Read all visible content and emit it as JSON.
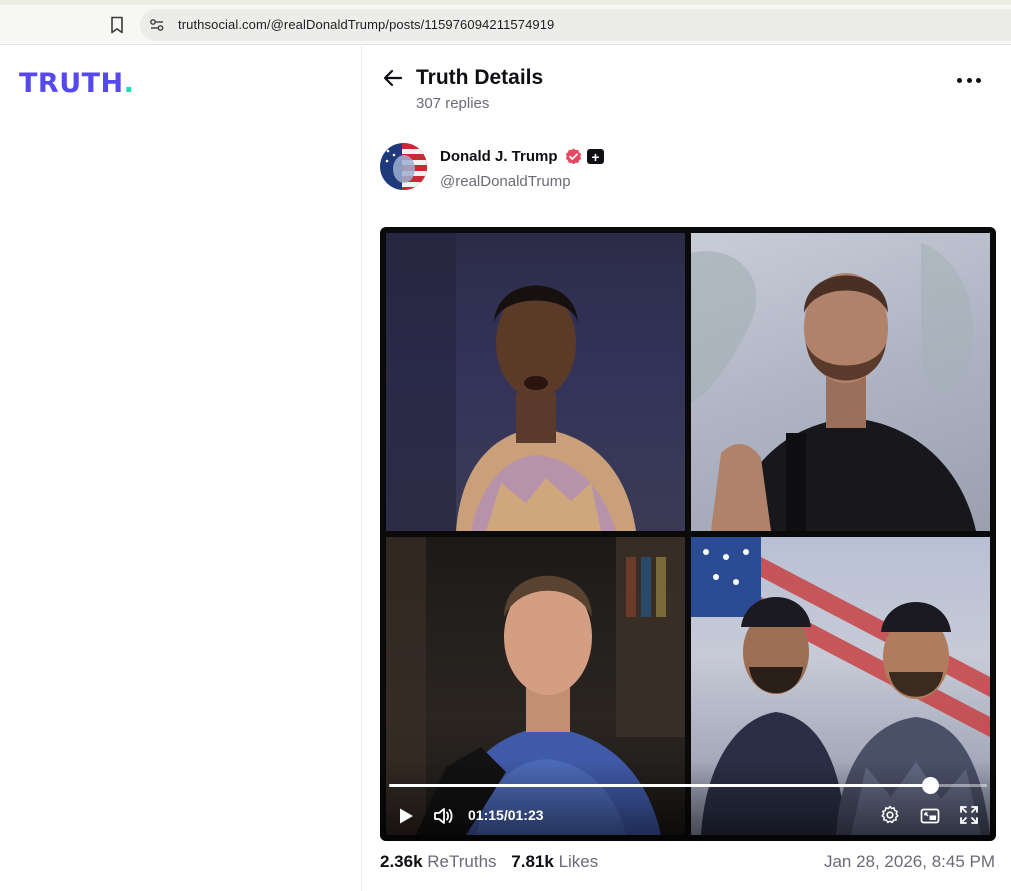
{
  "browser": {
    "url": "truthsocial.com/@realDonaldTrump/posts/115976094211574919"
  },
  "brand": {
    "logo_text": "TRUTH",
    "logo_dot": ".",
    "colors": {
      "logo": "#5448ee",
      "dot": "#17e2b5"
    }
  },
  "header": {
    "title": "Truth Details",
    "replies": "307 replies",
    "icons": {
      "back": "arrow-left-icon",
      "more": "more-horizontal-icon"
    }
  },
  "author": {
    "name": "Donald J. Trump",
    "handle": "@realDonaldTrump",
    "plus_badge": "+",
    "icons": {
      "verified": "verified-badge-icon",
      "plus": "plus-badge-icon"
    },
    "colors": {
      "verified": "#e8475f"
    }
  },
  "video": {
    "current_time": "01:15",
    "separator": "/",
    "duration": "01:23",
    "progress_fraction": 0.904,
    "icons": [
      "play-icon",
      "volume-icon",
      "settings-icon",
      "pip-icon",
      "fullscreen-icon"
    ]
  },
  "stats": {
    "retruths_count": "2.36k",
    "retruths_label": "ReTruths",
    "likes_count": "7.81k",
    "likes_label": "Likes",
    "date": "Jan 28, 2026, 8:45 PM"
  }
}
